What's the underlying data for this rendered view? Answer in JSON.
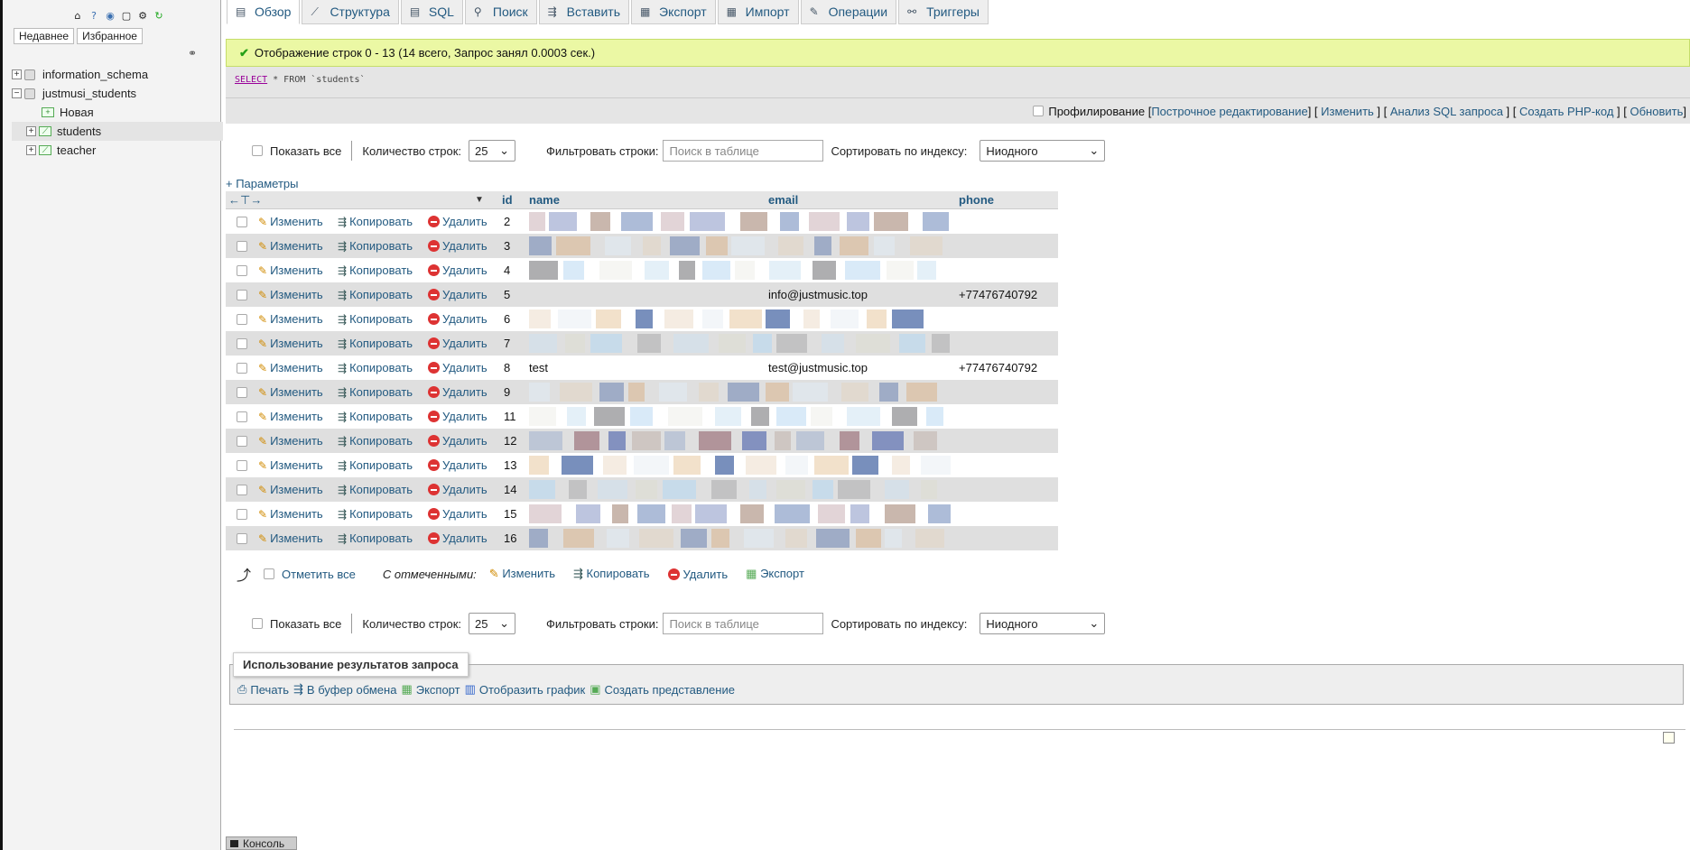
{
  "sidebar": {
    "tabs": [
      "Недавнее",
      "Избранное"
    ],
    "icons": [
      "home-icon",
      "help-icon",
      "docs-icon",
      "sql-icon",
      "settings-icon",
      "reload-icon"
    ],
    "tree": [
      {
        "label": "information_schema",
        "level": 0,
        "type": "db",
        "expanded": false
      },
      {
        "label": "justmusi_students",
        "level": 0,
        "type": "db",
        "expanded": true
      },
      {
        "label": "Новая",
        "level": 1,
        "type": "new"
      },
      {
        "label": "students",
        "level": 1,
        "type": "table",
        "selected": true
      },
      {
        "label": "teacher",
        "level": 1,
        "type": "table"
      }
    ]
  },
  "tabs": [
    {
      "label": "Обзор",
      "icon": "browse-icon",
      "active": true
    },
    {
      "label": "Структура",
      "icon": "structure-icon"
    },
    {
      "label": "SQL",
      "icon": "sql-icon"
    },
    {
      "label": "Поиск",
      "icon": "search-icon"
    },
    {
      "label": "Вставить",
      "icon": "insert-icon"
    },
    {
      "label": "Экспорт",
      "icon": "export-icon"
    },
    {
      "label": "Импорт",
      "icon": "import-icon"
    },
    {
      "label": "Операции",
      "icon": "operations-icon"
    },
    {
      "label": "Триггеры",
      "icon": "triggers-icon"
    }
  ],
  "message": "Отображение строк 0 - 13 (14 всего, Запрос занял 0.0003 сек.)",
  "sql": {
    "kw1": "SELECT",
    "rest": " * FROM `students`"
  },
  "profiling": {
    "label": "Профилирование",
    "links": [
      "Построчное редактирование",
      "Изменить",
      "Анализ SQL запроса",
      "Создать PHP-код",
      "Обновить"
    ]
  },
  "nav": {
    "show_all": "Показать все",
    "rows_label": "Количество строк:",
    "rows_value": "25",
    "filter_label": "Фильтровать строки:",
    "filter_placeholder": "Поиск в таблице",
    "sort_label": "Сортировать по индексу:",
    "sort_value": "Ниодного"
  },
  "params": "+ Параметры",
  "columns": [
    "id",
    "name",
    "email",
    "phone"
  ],
  "actions": {
    "edit": "Изменить",
    "copy": "Копировать",
    "delete": "Удалить"
  },
  "rows": [
    {
      "id": "2",
      "name": "",
      "email": "",
      "phone": ""
    },
    {
      "id": "3",
      "name": "",
      "email": "",
      "phone": ""
    },
    {
      "id": "4",
      "name": "",
      "email": "",
      "phone": ""
    },
    {
      "id": "5",
      "name": "",
      "email": "info@justmusic.top",
      "phone": "+77476740792"
    },
    {
      "id": "6",
      "name": "",
      "email": "",
      "phone": ""
    },
    {
      "id": "7",
      "name": "",
      "email": "",
      "phone": ""
    },
    {
      "id": "8",
      "name": "test",
      "email": "test@justmusic.top",
      "phone": "+77476740792"
    },
    {
      "id": "9",
      "name": "",
      "email": "",
      "phone": ""
    },
    {
      "id": "11",
      "name": "",
      "email": "",
      "phone": ""
    },
    {
      "id": "12",
      "name": "",
      "email": "",
      "phone": ""
    },
    {
      "id": "13",
      "name": "",
      "email": "",
      "phone": ""
    },
    {
      "id": "14",
      "name": "",
      "email": "",
      "phone": ""
    },
    {
      "id": "15",
      "name": "",
      "email": "",
      "phone": ""
    },
    {
      "id": "16",
      "name": "",
      "email": "",
      "phone": ""
    }
  ],
  "bulk": {
    "check_all": "Отметить все",
    "with_selected": "С отмеченными:",
    "edit": "Изменить",
    "copy": "Копировать",
    "delete": "Удалить",
    "export": "Экспорт"
  },
  "usage": {
    "title": "Использование результатов запроса",
    "items": [
      "Печать",
      "В буфер обмена",
      "Экспорт",
      "Отобразить график",
      "Создать представление"
    ]
  },
  "console": "Консоль"
}
